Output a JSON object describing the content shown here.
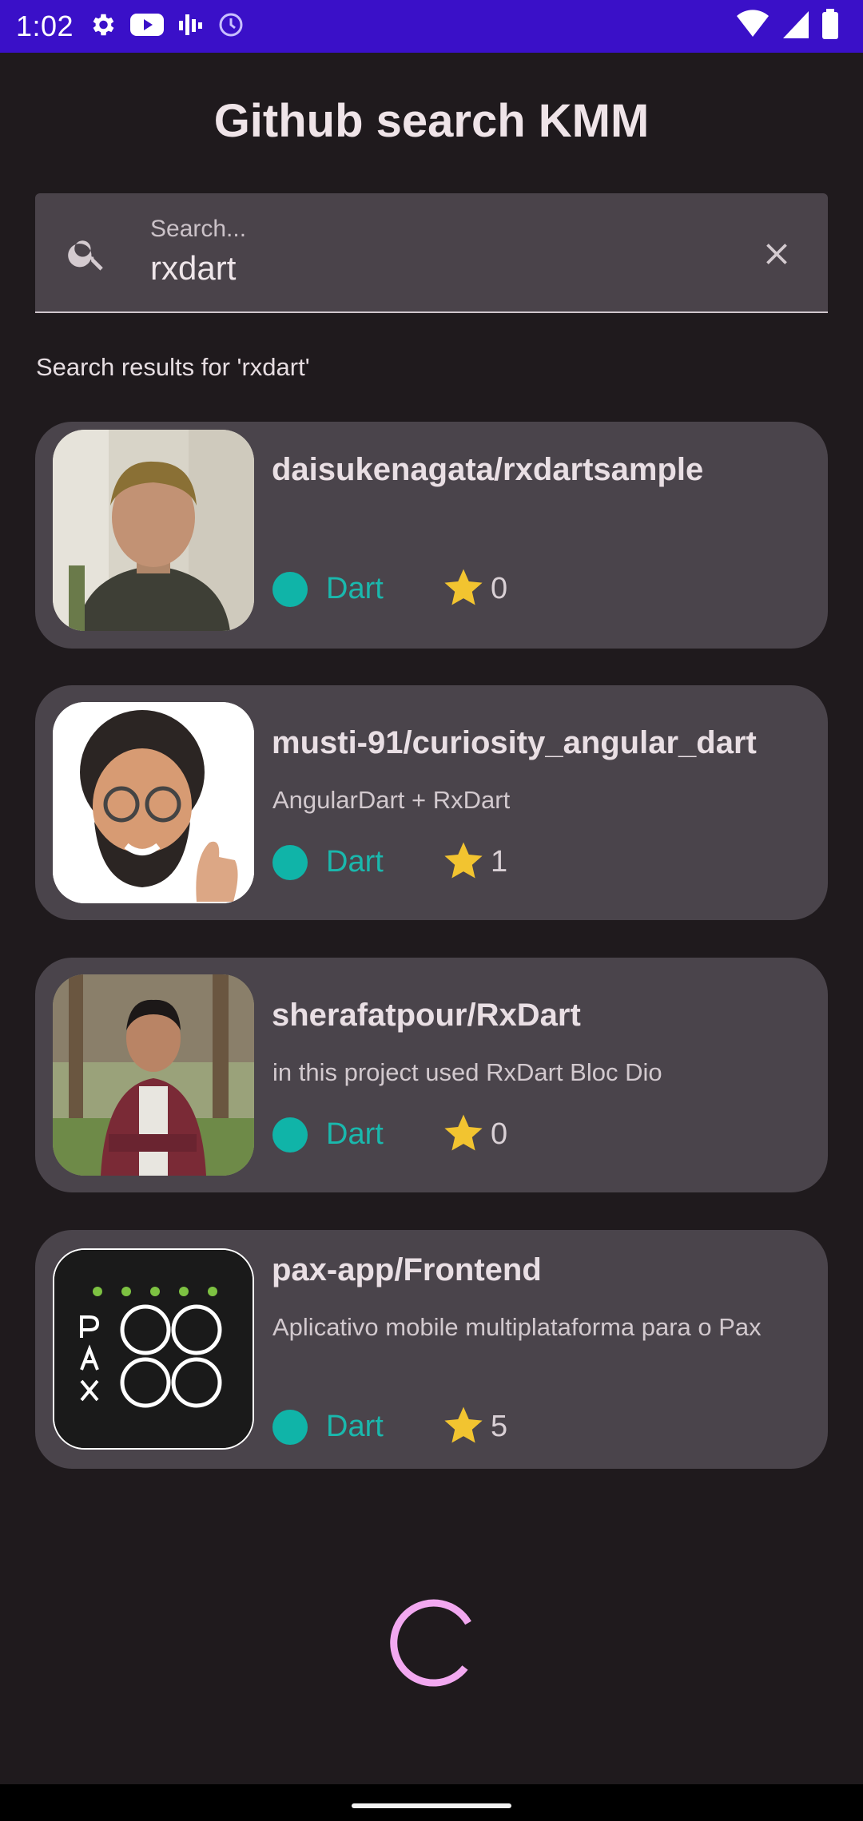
{
  "status_bar": {
    "time": "1:02",
    "left_icons": [
      "gear-icon",
      "youtube-icon",
      "signal-bars-icon",
      "clock-icon"
    ],
    "right_icons": [
      "wifi-icon",
      "cellular-icon",
      "battery-icon"
    ],
    "background": "#3a10c8"
  },
  "app": {
    "title": "Github search KMM"
  },
  "search": {
    "placeholder": "Search...",
    "value": "rxdart",
    "results_caption": "Search results for 'rxdart'"
  },
  "results": [
    {
      "name": "daisukenagata/rxdartsample",
      "description": "",
      "language": "Dart",
      "stars": "0",
      "avatar_icon": "person-photo-avatar"
    },
    {
      "name": "musti-91/curiosity_angular_dart",
      "description": "AngularDart + RxDart",
      "language": "Dart",
      "stars": "1",
      "avatar_icon": "memoji-avatar"
    },
    {
      "name": "sherafatpour/RxDart",
      "description": "in this project used RxDart Bloc Dio",
      "language": "Dart",
      "stars": "0",
      "avatar_icon": "person-photo-avatar"
    },
    {
      "name": "pax-app/Frontend",
      "description": "Aplicativo mobile multiplataforma para o Pax",
      "language": "Dart",
      "stars": "5",
      "avatar_icon": "pax-logo-avatar",
      "avatar_logo_text": "PAX"
    }
  ],
  "colors": {
    "background": "#1f1a1d",
    "card": "#4a444b",
    "language_dart": "#10b4a8",
    "star": "#f2c430",
    "spinner": "#f2a8f0"
  }
}
